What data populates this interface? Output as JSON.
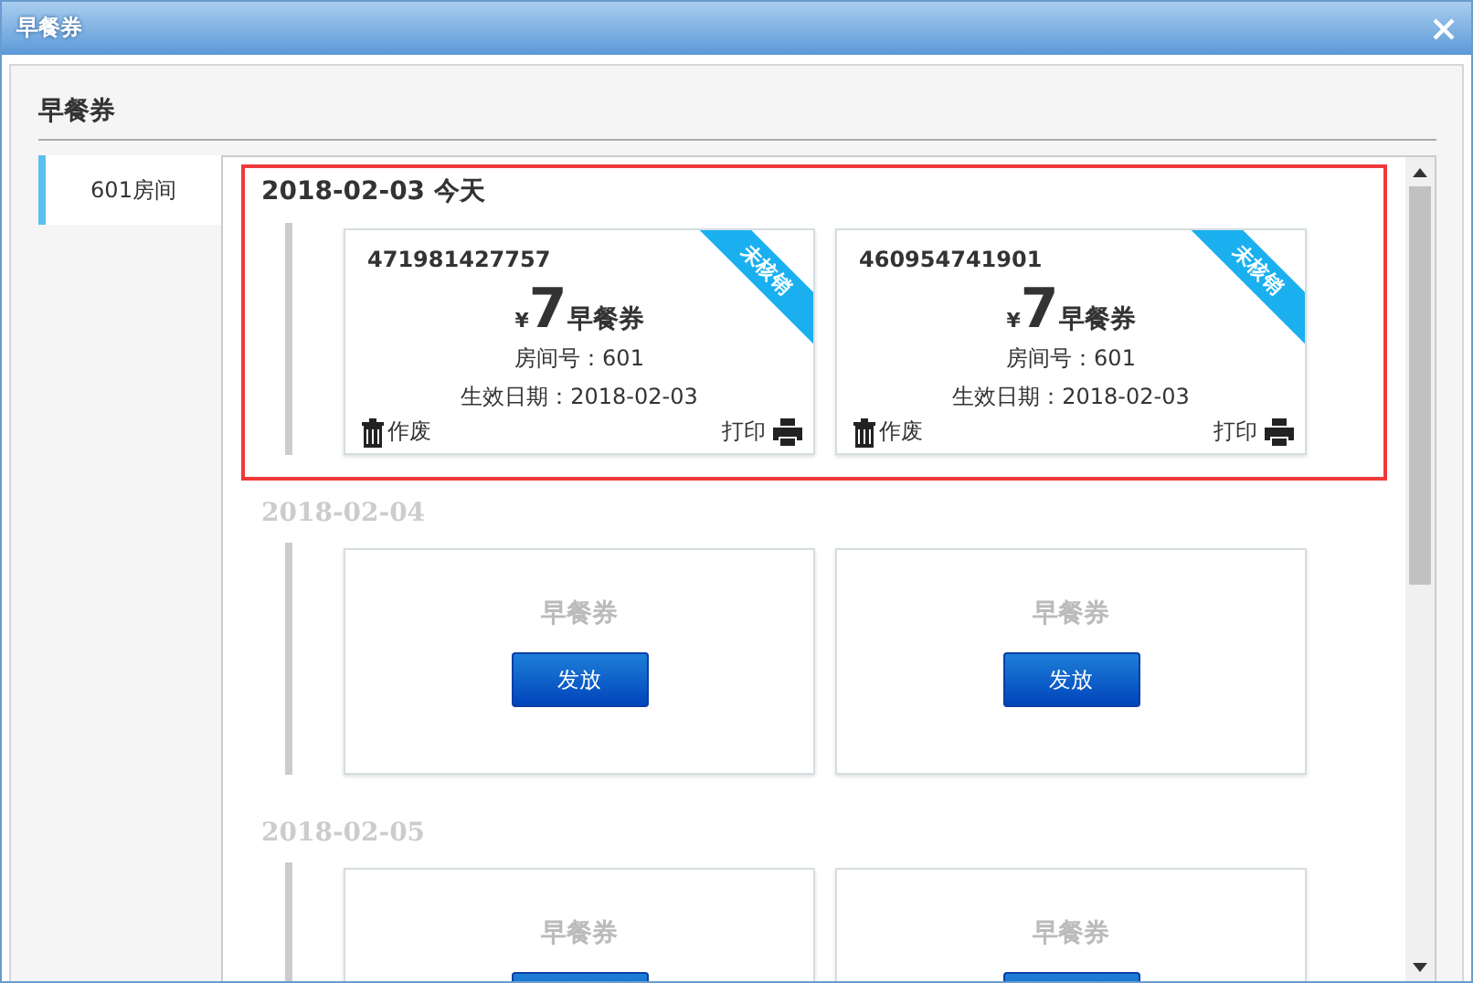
{
  "window": {
    "title": "早餐券"
  },
  "heading": "早餐券",
  "rooms": [
    {
      "label": "601房间",
      "selected": true
    }
  ],
  "days": [
    {
      "date": "2018-02-03 今天",
      "today": true,
      "slots": [
        {
          "kind": "ticket",
          "number": "471981427757",
          "currency": "¥",
          "amount": "7",
          "title": "早餐券",
          "room": "房间号：601",
          "valid": "生效日期：2018-02-03",
          "status": "未核销",
          "void": "作废",
          "print": "打印"
        },
        {
          "kind": "ticket",
          "number": "460954741901",
          "currency": "¥",
          "amount": "7",
          "title": "早餐券",
          "room": "房间号：601",
          "valid": "生效日期：2018-02-03",
          "status": "未核销",
          "void": "作废",
          "print": "打印"
        }
      ]
    },
    {
      "date": "2018-02-04",
      "today": false,
      "slots": [
        {
          "kind": "empty",
          "title": "早餐券",
          "button": "发放"
        },
        {
          "kind": "empty",
          "title": "早餐券",
          "button": "发放"
        }
      ]
    },
    {
      "date": "2018-02-05",
      "today": false,
      "slots": [
        {
          "kind": "empty",
          "title": "早餐券",
          "has_button": true
        },
        {
          "kind": "empty",
          "title": "早餐券",
          "has_button": true
        }
      ]
    }
  ]
}
